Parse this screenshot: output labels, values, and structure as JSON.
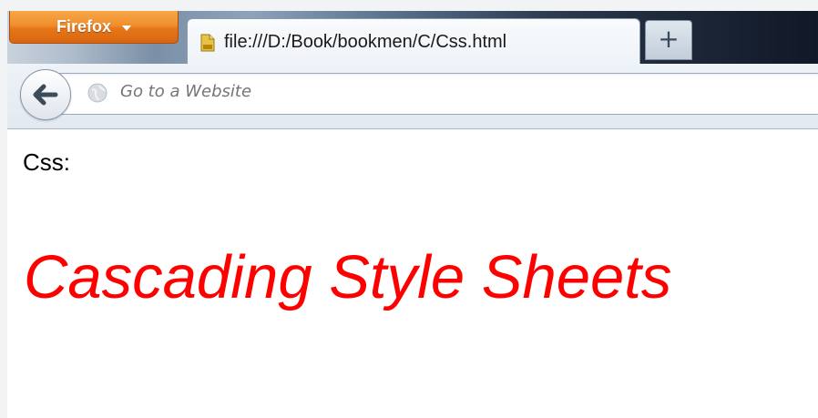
{
  "app_button": {
    "label": "Firefox",
    "color": "#f08f2c"
  },
  "tabs": [
    {
      "title": "file:///D:/Book/bookmen/C/Css.html",
      "icon": "html-file-icon",
      "active": true
    }
  ],
  "new_tab": {
    "label": "+"
  },
  "nav": {
    "back_icon": "back-arrow-icon",
    "site_icon": "globe-icon",
    "url_placeholder": "Go to a Website",
    "url_value": ""
  },
  "page": {
    "label": "Css:",
    "heading": "Cascading Style Sheets",
    "heading_color": "#ff0000"
  }
}
